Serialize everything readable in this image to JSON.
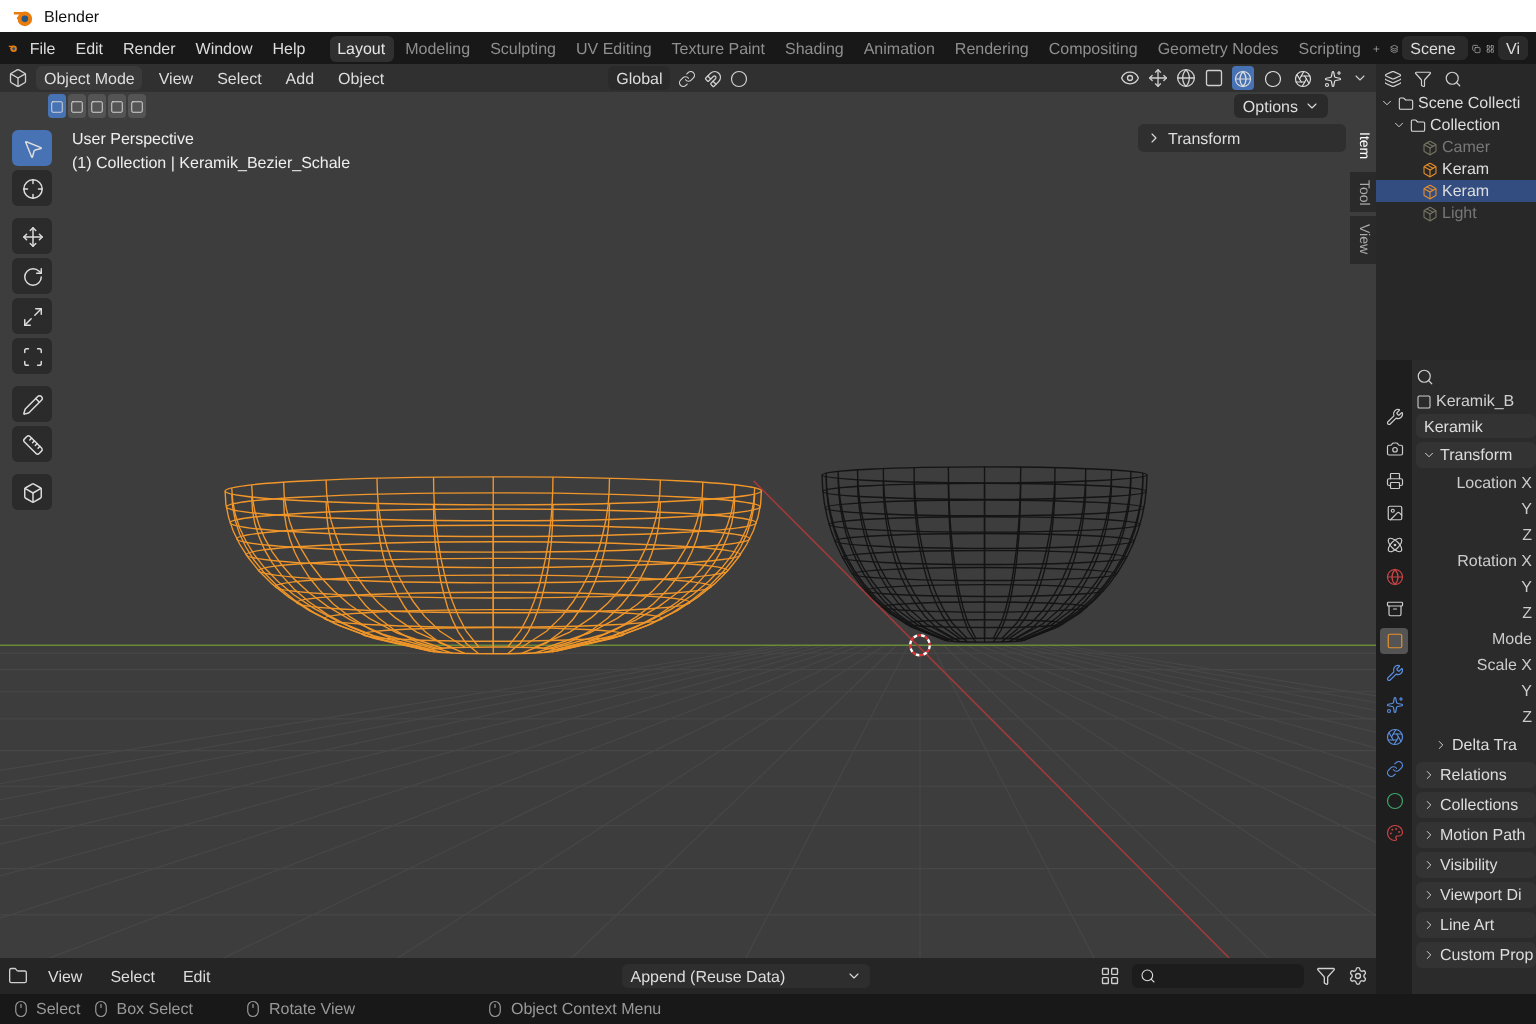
{
  "window": {
    "title": "Blender"
  },
  "menu": [
    "File",
    "Edit",
    "Render",
    "Window",
    "Help"
  ],
  "workspaces": [
    {
      "label": "Layout",
      "selected": true
    },
    {
      "label": "Modeling",
      "selected": false
    },
    {
      "label": "Sculpting",
      "selected": false
    },
    {
      "label": "UV Editing",
      "selected": false
    },
    {
      "label": "Texture Paint",
      "selected": false
    },
    {
      "label": "Shading",
      "selected": false
    },
    {
      "label": "Animation",
      "selected": false
    },
    {
      "label": "Rendering",
      "selected": false
    },
    {
      "label": "Compositing",
      "selected": false
    },
    {
      "label": "Geometry Nodes",
      "selected": false
    },
    {
      "label": "Scripting",
      "selected": false
    }
  ],
  "scene": "Scene",
  "view_layer": "Vi",
  "viewport_header": {
    "mode": "Object Mode",
    "menus": [
      "View",
      "Select",
      "Add",
      "Object"
    ],
    "orientation": "Global",
    "options": "Options",
    "select_modes": [
      {
        "selected": true
      },
      {
        "selected": false
      },
      {
        "selected": false
      },
      {
        "selected": false
      },
      {
        "selected": false
      }
    ],
    "shading_modes": [
      {
        "selected": true
      },
      {
        "selected": false
      },
      {
        "selected": false
      },
      {
        "selected": false
      }
    ]
  },
  "viewport": {
    "perspective": "User Perspective",
    "collection": "(1) Collection | Keramik_Bezier_Schale"
  },
  "tools": [
    {
      "selected": true
    },
    {
      "selected": false
    },
    {
      "selected": false
    },
    {
      "selected": false
    },
    {
      "selected": false
    },
    {
      "selected": false
    },
    {
      "selected": false
    },
    {
      "selected": false
    },
    {
      "selected": false
    }
  ],
  "sidebar": {
    "panel": "Transform",
    "tabs": [
      {
        "label": "Item",
        "selected": true
      },
      {
        "label": "Tool",
        "selected": false
      },
      {
        "label": "View",
        "selected": false
      }
    ]
  },
  "outliner": {
    "items": [
      {
        "label": "Scene Collecti",
        "selected": false,
        "dimmed": false,
        "children": [
          {
            "label": "Collection",
            "selected": false,
            "dimmed": false,
            "children": [
              {
                "label": "Camer",
                "selected": false,
                "dimmed": true
              },
              {
                "label": "Keram",
                "selected": false,
                "dimmed": false
              },
              {
                "label": "Keram",
                "selected": true,
                "dimmed": false
              },
              {
                "label": "Light",
                "selected": false,
                "dimmed": true
              }
            ]
          }
        ]
      }
    ]
  },
  "properties": {
    "object_name": "Keramik_B",
    "data_name": "Keramik",
    "tabs": [
      {
        "selected": false
      },
      {
        "selected": false
      },
      {
        "selected": false
      },
      {
        "selected": false
      },
      {
        "selected": false
      },
      {
        "selected": false
      },
      {
        "selected": false
      },
      {
        "selected": true
      },
      {
        "selected": false
      },
      {
        "selected": false
      },
      {
        "selected": false
      },
      {
        "selected": false
      },
      {
        "selected": false
      },
      {
        "selected": false
      }
    ],
    "sections": [
      {
        "label": "Transform",
        "expanded": true,
        "fields": [
          "Location X",
          "Y",
          "Z",
          "Rotation X",
          "Y",
          "Z",
          "Mode",
          "Scale X",
          "Y",
          "Z"
        ],
        "subsections": [
          {
            "label": "Delta Tra",
            "expanded": false
          }
        ]
      },
      {
        "label": "Relations",
        "expanded": false
      },
      {
        "label": "Collections",
        "expanded": false
      },
      {
        "label": "Motion Path",
        "expanded": false
      },
      {
        "label": "Visibility",
        "expanded": false
      },
      {
        "label": "Viewport Di",
        "expanded": false
      },
      {
        "label": "Line Art",
        "expanded": false
      },
      {
        "label": "Custom Prop",
        "expanded": false
      }
    ]
  },
  "file_browser": {
    "menus": [
      "View",
      "Select",
      "Edit"
    ],
    "import_mode": "Append (Reuse Data)"
  },
  "status_bar": [
    "Select",
    "Box Select",
    "Rotate View",
    "Object Context Menu"
  ]
}
